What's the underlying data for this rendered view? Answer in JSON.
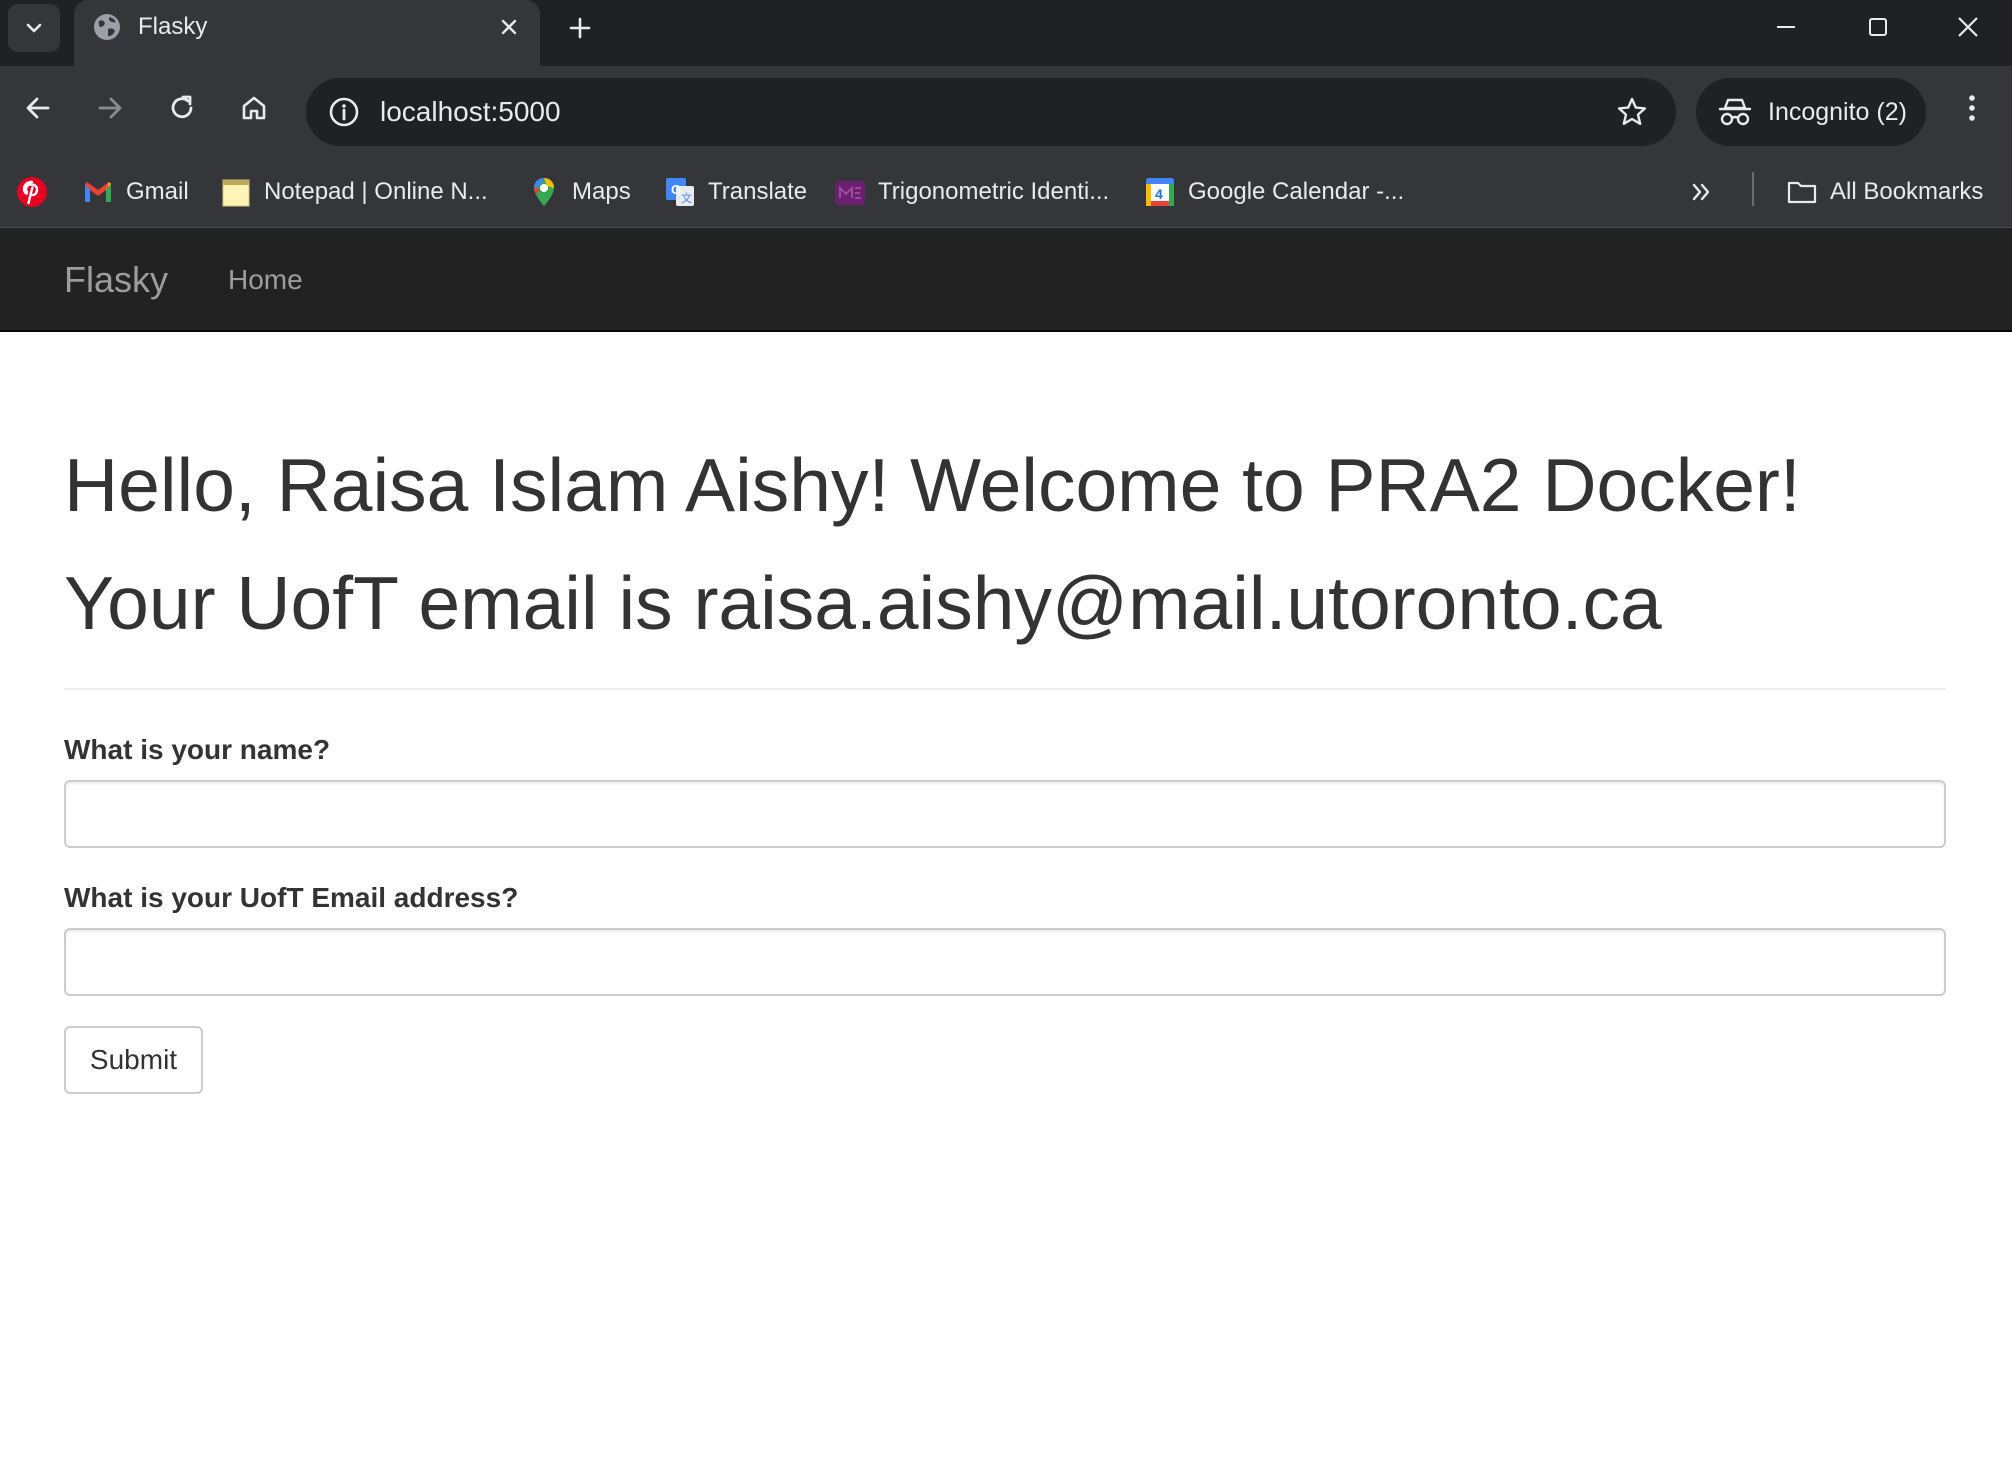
{
  "browser": {
    "tab": {
      "title": "Flasky"
    },
    "address_bar": {
      "url": "localhost:5000"
    },
    "profile": {
      "label": "Incognito (2)"
    },
    "bookmarks": [
      {
        "label": "",
        "icon": "pinterest-icon",
        "color": "#e60023"
      },
      {
        "label": "Gmail",
        "icon": "gmail-icon"
      },
      {
        "label": "Notepad | Online N...",
        "icon": "notepad-icon"
      },
      {
        "label": "Maps",
        "icon": "maps-icon"
      },
      {
        "label": "Translate",
        "icon": "translate-icon"
      },
      {
        "label": "Trigonometric Identi...",
        "icon": "trig-site-icon"
      },
      {
        "label": "Google Calendar -...",
        "icon": "calendar-icon"
      }
    ],
    "calendar_icon_day": "4",
    "all_bookmarks": "All Bookmarks"
  },
  "app": {
    "brand": "Flasky",
    "nav": {
      "home": "Home"
    },
    "greeting": "Hello, Raisa Islam Aishy! Welcome to PRA2 Docker!",
    "email_line": "Your UofT email is raisa.aishy@mail.utoronto.ca",
    "form": {
      "name_label": "What is your name?",
      "name_value": "",
      "email_label": "What is your UofT Email address?",
      "email_value": "",
      "submit_label": "Submit"
    }
  },
  "colors": {
    "chrome_dark": "#202124",
    "chrome_toolbar": "#35363a",
    "navbar_bg": "#222222",
    "navbar_text": "#9d9d9d",
    "heading_text": "#333333"
  }
}
